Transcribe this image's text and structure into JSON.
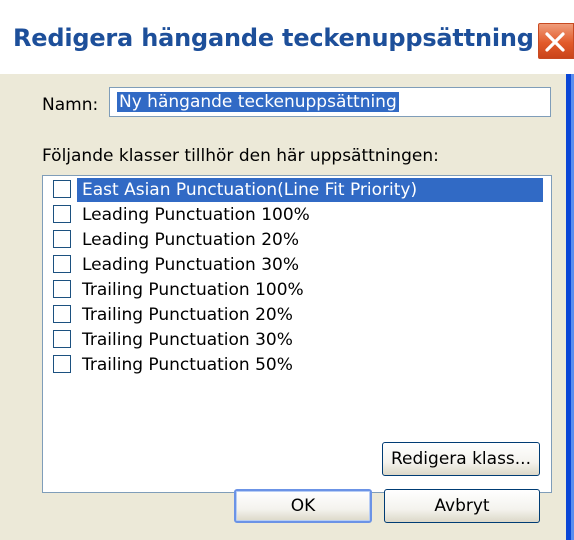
{
  "window": {
    "title": "Redigera hängande teckenuppsättning",
    "close_icon": "close-icon"
  },
  "name": {
    "label": "Namn:",
    "value": "Ny hängande teckenuppsättning"
  },
  "classes": {
    "label": "Följande klasser tillhör den här uppsättningen:",
    "items": [
      {
        "label": "East Asian Punctuation(Line Fit Priority)",
        "checked": false,
        "selected": true
      },
      {
        "label": "Leading Punctuation 100%",
        "checked": false,
        "selected": false
      },
      {
        "label": "Leading Punctuation 20%",
        "checked": false,
        "selected": false
      },
      {
        "label": "Leading Punctuation 30%",
        "checked": false,
        "selected": false
      },
      {
        "label": "Trailing Punctuation 100%",
        "checked": false,
        "selected": false
      },
      {
        "label": "Trailing Punctuation 20%",
        "checked": false,
        "selected": false
      },
      {
        "label": "Trailing Punctuation 30%",
        "checked": false,
        "selected": false
      },
      {
        "label": "Trailing Punctuation 50%",
        "checked": false,
        "selected": false
      }
    ]
  },
  "buttons": {
    "edit_class": "Redigera klass...",
    "ok": "OK",
    "cancel": "Avbryt"
  },
  "colors": {
    "title_text": "#1d4f9a",
    "selection": "#316ac5",
    "dialog_background": "#ece9d8",
    "close_button": "#e25a2a"
  }
}
